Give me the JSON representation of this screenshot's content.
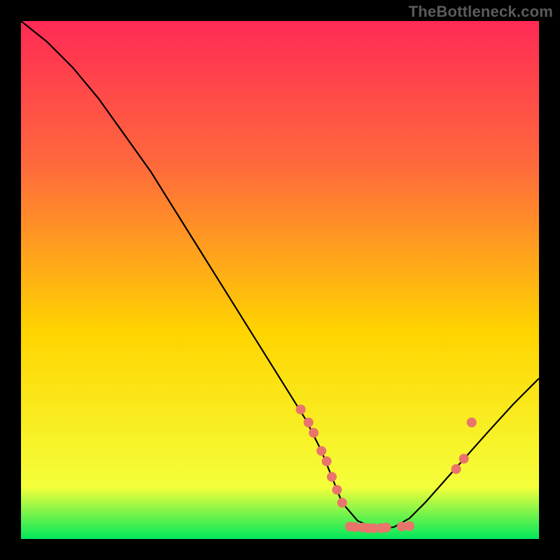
{
  "watermark": "TheBottleneck.com",
  "chart_data": {
    "type": "line",
    "title": "",
    "xlabel": "",
    "ylabel": "",
    "xlim": [
      0,
      100
    ],
    "ylim": [
      0,
      100
    ],
    "background_gradient": {
      "top": "#ff2a55",
      "mid": "#ffd400",
      "bottom": "#00e85a"
    },
    "curve": {
      "description": "V-shaped bottleneck curve (black), minimum plateau near x≈62–72, left arm concave from top-left, right arm rising to ~y≈30 at x=100",
      "x": [
        0,
        5,
        10,
        15,
        20,
        25,
        30,
        35,
        40,
        45,
        50,
        55,
        58,
        60,
        62,
        65,
        68,
        70,
        72,
        75,
        78,
        82,
        86,
        90,
        95,
        100
      ],
      "y": [
        100,
        96,
        91,
        85,
        78,
        71,
        63,
        55,
        47,
        39,
        31,
        23,
        17,
        12,
        7,
        3.5,
        2.2,
        2,
        2.3,
        4,
        7,
        11.5,
        16,
        20.5,
        26,
        31
      ]
    },
    "markers": {
      "description": "salmon circular points sitting on the curve",
      "color": "#e9746c",
      "radius": 7,
      "points": [
        {
          "x": 54,
          "y": 25
        },
        {
          "x": 55.5,
          "y": 22.5
        },
        {
          "x": 56.5,
          "y": 20.5
        },
        {
          "x": 58,
          "y": 17
        },
        {
          "x": 59,
          "y": 15
        },
        {
          "x": 60,
          "y": 12
        },
        {
          "x": 61,
          "y": 9.5
        },
        {
          "x": 62,
          "y": 7
        },
        {
          "x": 63.5,
          "y": 2.4
        },
        {
          "x": 64.5,
          "y": 2.3
        },
        {
          "x": 66,
          "y": 2.2
        },
        {
          "x": 67,
          "y": 2.1
        },
        {
          "x": 68,
          "y": 2.1
        },
        {
          "x": 69.5,
          "y": 2.1
        },
        {
          "x": 70.5,
          "y": 2.2
        },
        {
          "x": 73.5,
          "y": 2.4
        },
        {
          "x": 75,
          "y": 2.5
        },
        {
          "x": 84,
          "y": 13.5
        },
        {
          "x": 85.5,
          "y": 15.5
        },
        {
          "x": 87,
          "y": 22.5
        }
      ]
    }
  }
}
